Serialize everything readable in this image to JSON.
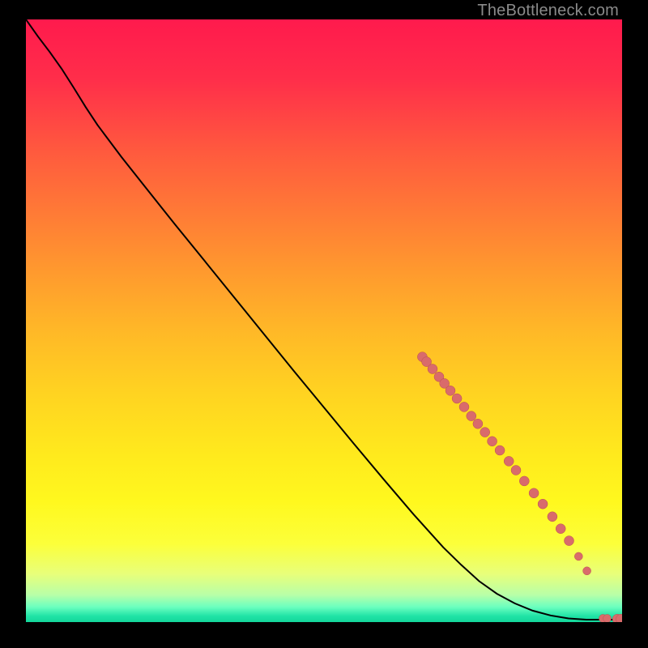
{
  "watermark": "TheBottleneck.com",
  "chart_data": {
    "type": "line",
    "title": "",
    "xlabel": "",
    "ylabel": "",
    "x_range_fraction": [
      0,
      1
    ],
    "y_range_fraction": [
      0,
      1
    ],
    "curve_fraction": [
      [
        0.0,
        0.0
      ],
      [
        0.02,
        0.028
      ],
      [
        0.04,
        0.054
      ],
      [
        0.06,
        0.082
      ],
      [
        0.08,
        0.113
      ],
      [
        0.1,
        0.145
      ],
      [
        0.12,
        0.175
      ],
      [
        0.16,
        0.228
      ],
      [
        0.2,
        0.278
      ],
      [
        0.25,
        0.34
      ],
      [
        0.3,
        0.401
      ],
      [
        0.35,
        0.462
      ],
      [
        0.4,
        0.523
      ],
      [
        0.45,
        0.584
      ],
      [
        0.5,
        0.644
      ],
      [
        0.55,
        0.704
      ],
      [
        0.6,
        0.763
      ],
      [
        0.65,
        0.821
      ],
      [
        0.7,
        0.876
      ],
      [
        0.73,
        0.905
      ],
      [
        0.76,
        0.932
      ],
      [
        0.79,
        0.953
      ],
      [
        0.82,
        0.969
      ],
      [
        0.85,
        0.981
      ],
      [
        0.88,
        0.989
      ],
      [
        0.91,
        0.994
      ],
      [
        0.94,
        0.996
      ],
      [
        0.97,
        0.996
      ],
      [
        1.0,
        0.996
      ]
    ],
    "markers_fraction": [
      [
        0.665,
        0.56,
        6
      ],
      [
        0.672,
        0.568,
        6
      ],
      [
        0.682,
        0.58,
        6
      ],
      [
        0.693,
        0.593,
        6
      ],
      [
        0.702,
        0.604,
        6
      ],
      [
        0.712,
        0.616,
        6
      ],
      [
        0.723,
        0.629,
        6
      ],
      [
        0.735,
        0.643,
        6
      ],
      [
        0.747,
        0.658,
        6
      ],
      [
        0.758,
        0.671,
        6
      ],
      [
        0.77,
        0.685,
        6
      ],
      [
        0.782,
        0.7,
        6
      ],
      [
        0.795,
        0.715,
        6
      ],
      [
        0.81,
        0.733,
        6
      ],
      [
        0.822,
        0.748,
        6
      ],
      [
        0.836,
        0.766,
        6
      ],
      [
        0.852,
        0.786,
        6
      ],
      [
        0.867,
        0.804,
        6
      ],
      [
        0.883,
        0.825,
        6
      ],
      [
        0.897,
        0.845,
        6
      ],
      [
        0.911,
        0.865,
        6
      ],
      [
        0.927,
        0.891,
        5
      ],
      [
        0.941,
        0.915,
        5
      ],
      [
        0.968,
        0.994,
        5
      ],
      [
        0.975,
        0.994,
        5
      ],
      [
        0.992,
        0.995,
        6
      ],
      [
        0.998,
        0.995,
        6
      ]
    ],
    "colors": {
      "curve": "#000000",
      "marker_fill": "#d96b6b",
      "marker_stroke": "#b94f4f"
    }
  }
}
